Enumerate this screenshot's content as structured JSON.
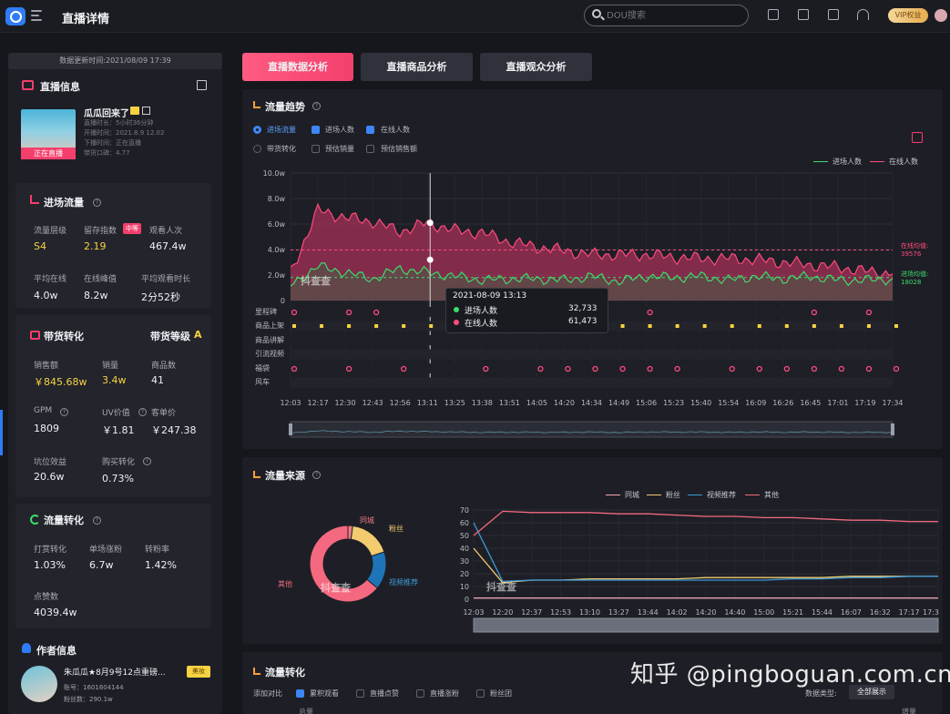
{
  "header": {
    "title": "直播详情",
    "search_placeholder": "DOU搜索",
    "vip_label": "VIP权益"
  },
  "sidebar": {
    "update_time": "数据更新时间:2021/08/09 17:39",
    "live_info": {
      "title": "直播信息",
      "name": "瓜瓜回来了",
      "meta": [
        "直播时长：5小时36分钟",
        "开播时间：2021.8.9 12.02",
        "下播时间：正在直播",
        "带货口碑：4.77"
      ],
      "badge": "正在直播"
    },
    "traffic": {
      "title": "进场流量",
      "metrics": [
        {
          "label": "流量层级",
          "value": "S4"
        },
        {
          "label": "留存指数",
          "value": "2.19",
          "tag": "中等"
        },
        {
          "label": "观看人次",
          "value": "467.4w"
        },
        {
          "label": "平均在线",
          "value": "4.0w"
        },
        {
          "label": "在线峰值",
          "value": "8.2w"
        },
        {
          "label": "平均观看时长",
          "value": "2分52秒"
        }
      ]
    },
    "goods": {
      "title": "带货转化",
      "level_label": "带货等级",
      "level": "A",
      "metrics": [
        {
          "label": "销售额",
          "value": "￥845.68w"
        },
        {
          "label": "销量",
          "value": "3.4w"
        },
        {
          "label": "商品数",
          "value": "41"
        },
        {
          "label": "GPM",
          "value": "1809"
        },
        {
          "label": "UV价值",
          "value": "￥1.81"
        },
        {
          "label": "客单价",
          "value": "￥247.38"
        },
        {
          "label": "坑位效益",
          "value": "20.6w"
        },
        {
          "label": "购买转化",
          "value": "0.73%"
        }
      ]
    },
    "flow": {
      "title": "流量转化",
      "metrics": [
        {
          "label": "打赏转化",
          "value": "1.03%"
        },
        {
          "label": "单场涨粉",
          "value": "6.7w"
        },
        {
          "label": "转粉率",
          "value": "1.42%"
        },
        {
          "label": "点赞数",
          "value": "4039.4w"
        }
      ]
    },
    "author": {
      "title": "作者信息",
      "name": "朱瓜瓜★8月9号12点重磅...",
      "tag": "美妆",
      "account": "账号：1601604144",
      "fans": "粉丝数：290.1w"
    }
  },
  "tabs": [
    "直播数据分析",
    "直播商品分析",
    "直播观众分析"
  ],
  "trend": {
    "title": "流量趋势",
    "radio_label": "进场流量",
    "checks": [
      {
        "label": "进场人数",
        "checked": true
      },
      {
        "label": "在线人数",
        "checked": true
      }
    ],
    "radio2_label": "带货转化",
    "checks2": [
      {
        "label": "预估销量",
        "checked": false
      },
      {
        "label": "预估销售额",
        "checked": false
      }
    ],
    "legend": [
      "进场人数",
      "在线人数"
    ],
    "avg_online_label": "在线均值:",
    "avg_online_value": "39576",
    "avg_entry_label": "进场均值:",
    "avg_entry_value": "18028",
    "watermark": "抖查查",
    "tooltip": {
      "time": "2021-08-09 13:13",
      "rows": [
        {
          "label": "进场人数",
          "value": "32,733"
        },
        {
          "label": "在线人数",
          "value": "61,473"
        }
      ]
    },
    "event_labels": [
      "里程碑",
      "商品上架",
      "商品讲解",
      "引流视频",
      "福袋",
      "风车"
    ],
    "colors": {
      "entry": "#3ddc6a",
      "online": "#ff4a7d",
      "accent": "#f43f6c"
    }
  },
  "source": {
    "title": "流量来源",
    "legend": [
      "同城",
      "粉丝",
      "视频推荐",
      "其他"
    ],
    "watermark": "抖查查",
    "pie_labels": [
      "同城",
      "粉丝",
      "视频推荐",
      "其他"
    ]
  },
  "conversion": {
    "title": "流量转化",
    "compare_label": "添加对比",
    "checks": [
      {
        "label": "累积观看",
        "checked": true
      },
      {
        "label": "直播点赞",
        "checked": false
      },
      {
        "label": "直播涨粉",
        "checked": false
      },
      {
        "label": "粉丝团",
        "checked": false
      }
    ],
    "type_label": "数据类型:",
    "type_value": "全部展示",
    "col_header": "总量",
    "col_header2": "增量"
  },
  "watermark_overlay": "知乎 @pingboguan.com.cn",
  "chart_data": [
    {
      "type": "area",
      "title": "流量趋势",
      "ylim": [
        0,
        10
      ],
      "yticks": [
        "10.0w",
        "8.0w",
        "6.0w",
        "4.0w",
        "2.0w",
        "0"
      ],
      "x": [
        "12:03",
        "12:17",
        "12:30",
        "12:43",
        "12:56",
        "13:11",
        "13:25",
        "13:38",
        "13:51",
        "14:05",
        "14:20",
        "14:34",
        "14:49",
        "15:06",
        "15:23",
        "15:40",
        "15:54",
        "16:09",
        "16:26",
        "16:45",
        "17:01",
        "17:19",
        "17:34"
      ],
      "series": [
        {
          "name": "在线人数",
          "values": [
            2.2,
            7.1,
            6.5,
            6.2,
            5.4,
            6.1,
            5.5,
            5.3,
            4.6,
            4.2,
            3.9,
            3.6,
            3.6,
            3.6,
            3.4,
            3.3,
            3.3,
            3.2,
            3.0,
            2.8,
            2.6,
            2.3,
            2.1
          ]
        },
        {
          "name": "进场人数",
          "values": [
            1.2,
            2.7,
            2.2,
            1.7,
            2.5,
            2.2,
            1.9,
            1.6,
            1.7,
            1.7,
            1.6,
            1.9,
            1.5,
            1.9,
            1.8,
            1.9,
            1.6,
            1.9,
            1.7,
            1.9,
            1.6,
            1.6,
            1.7
          ]
        }
      ],
      "avg_online": 3.96,
      "avg_entry": 1.8,
      "events": {
        "里程碑": [
          "12:03",
          "12:30",
          "12:43",
          "13:38",
          "14:05",
          "14:20",
          "15:06",
          "16:45",
          "17:19"
        ],
        "商品上架": [
          "12:03",
          "12:17",
          "12:30",
          "12:43",
          "12:56",
          "13:11",
          "13:25",
          "13:38",
          "13:51",
          "14:05",
          "14:20",
          "14:34",
          "14:49",
          "15:06",
          "15:23",
          "15:40",
          "15:54",
          "16:09",
          "16:26",
          "16:45",
          "17:01",
          "17:19",
          "17:34"
        ],
        "福袋": [
          "12:03",
          "12:30",
          "12:56",
          "13:38",
          "14:05",
          "14:20",
          "14:34",
          "14:49",
          "15:06",
          "15:23",
          "15:54",
          "16:09",
          "16:26",
          "16:45",
          "17:01",
          "17:19",
          "17:34"
        ]
      }
    },
    {
      "type": "pie",
      "title": "流量来源",
      "labels": [
        "同城",
        "粉丝",
        "视频推荐",
        "其他"
      ],
      "values": [
        2,
        18,
        16,
        64
      ],
      "colors": [
        "#f07a86",
        "#f2cc6f",
        "#1f74b8",
        "#f4697f"
      ]
    },
    {
      "type": "line",
      "ylim": [
        0,
        70
      ],
      "yticks": [
        "70",
        "60",
        "50",
        "40",
        "30",
        "20",
        "10",
        "0"
      ],
      "x": [
        "12:03",
        "12:20",
        "12:37",
        "12:53",
        "13:10",
        "13:27",
        "13:44",
        "14:02",
        "14:20",
        "14:40",
        "15:00",
        "15:21",
        "15:44",
        "16:07",
        "16:32",
        "17:17",
        "17:3"
      ],
      "series": [
        {
          "name": "同城",
          "values": [
            1,
            1,
            1,
            1,
            1,
            1,
            1,
            1,
            1,
            1,
            1,
            1,
            1,
            1,
            1,
            1,
            1
          ]
        },
        {
          "name": "粉丝",
          "values": [
            40,
            13,
            15,
            15,
            16,
            16,
            16,
            16,
            17,
            17,
            17,
            17,
            17,
            18,
            18,
            18,
            18
          ]
        },
        {
          "name": "视频推荐",
          "values": [
            60,
            14,
            15,
            15,
            15,
            15,
            15,
            15,
            15,
            15,
            15,
            16,
            16,
            17,
            17,
            18,
            18
          ]
        },
        {
          "name": "其他",
          "values": [
            50,
            69,
            68,
            68,
            68,
            67,
            67,
            66,
            65,
            65,
            64,
            64,
            63,
            62,
            62,
            61,
            61
          ]
        }
      ],
      "colors": {
        "同城": "#f7a8b2",
        "粉丝": "#f2cc6f",
        "视频推荐": "#3d9ad8",
        "其他": "#f4697f"
      }
    }
  ]
}
